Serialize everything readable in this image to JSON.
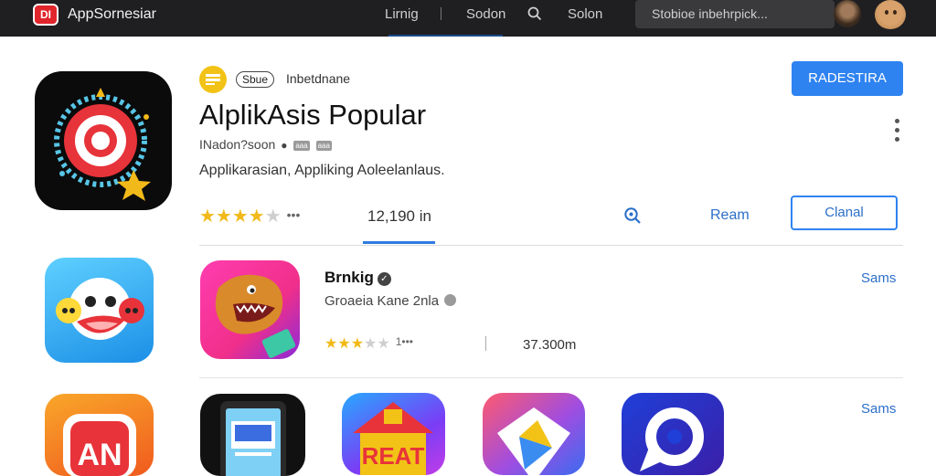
{
  "topbar": {
    "logo_text": "DI",
    "brand": "AppSornesiar",
    "nav": [
      "Lirnig",
      "Sodon",
      "Solon"
    ],
    "search_placeholder": "Stobioe inbehrpick...",
    "accent": "#1f1f22"
  },
  "hero": {
    "chip": "Sbue",
    "chip_text": "Inbetdnane",
    "title": "AlplikAsis Popular",
    "meta": "INadon?soon",
    "meta_badges": [
      "aaa",
      "aaa"
    ],
    "description": "Applikarasian, Appliking Aoleelanlaus.",
    "install_label": "RADESTIRA",
    "rating_stars": 4,
    "rating_more": "•••",
    "count": "12,190 in",
    "zoom_icon": "search-zoom-icon",
    "secondary_link": "Ream",
    "secondary_button": "Clanal",
    "brand_color": "#2f83f0"
  },
  "row1": {
    "title": "Brnkig",
    "subtitle": "Groaeia Kane 2nla",
    "rating_stars": 3.5,
    "rating_more": "1•••",
    "count": "37.300m",
    "see_all": "Sams"
  },
  "row2": {
    "see_all": "Sams",
    "icons": [
      "AN",
      "phone-app",
      "REAT",
      "play-app",
      "circle-app"
    ]
  }
}
